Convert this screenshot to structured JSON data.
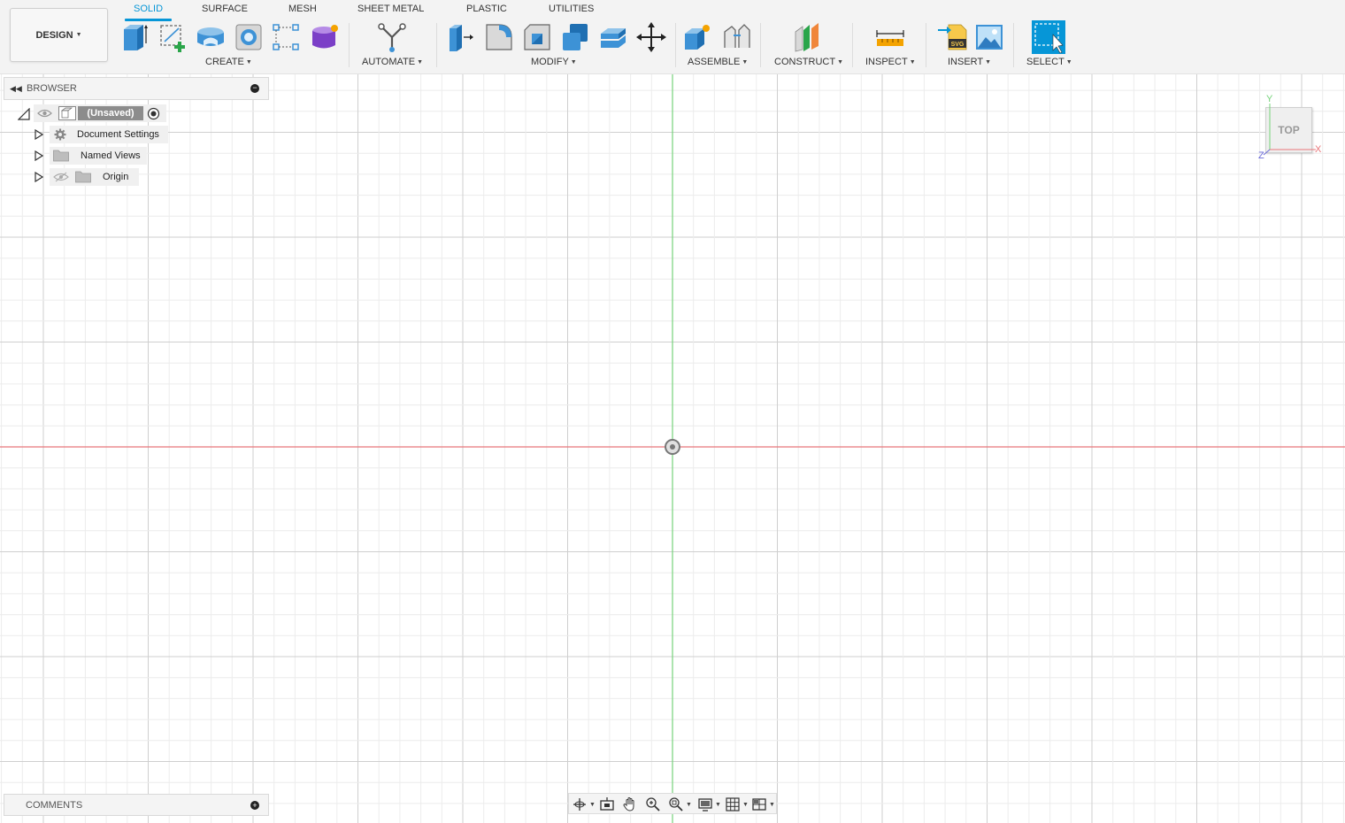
{
  "workspace": {
    "label": "DESIGN"
  },
  "tabs": [
    {
      "label": "SOLID",
      "active": true
    },
    {
      "label": "SURFACE"
    },
    {
      "label": "MESH"
    },
    {
      "label": "SHEET METAL"
    },
    {
      "label": "PLASTIC"
    },
    {
      "label": "UTILITIES"
    }
  ],
  "groups": {
    "create": "CREATE",
    "automate": "AUTOMATE",
    "modify": "MODIFY",
    "assemble": "ASSEMBLE",
    "construct": "CONSTRUCT",
    "inspect": "INSPECT",
    "insert": "INSERT",
    "select": "SELECT"
  },
  "browser": {
    "title": "BROWSER",
    "root": "(Unsaved)",
    "items": [
      "Document Settings",
      "Named Views",
      "Origin"
    ]
  },
  "comments": {
    "title": "COMMENTS"
  },
  "viewcube": {
    "face": "TOP",
    "axes": {
      "y": "Y",
      "x": "X",
      "z": "Z"
    }
  },
  "colors": {
    "accent": "#0696d7",
    "x_axis": "#e8767a",
    "y_axis": "#76d37a",
    "z_axis": "#6b6bd8"
  }
}
